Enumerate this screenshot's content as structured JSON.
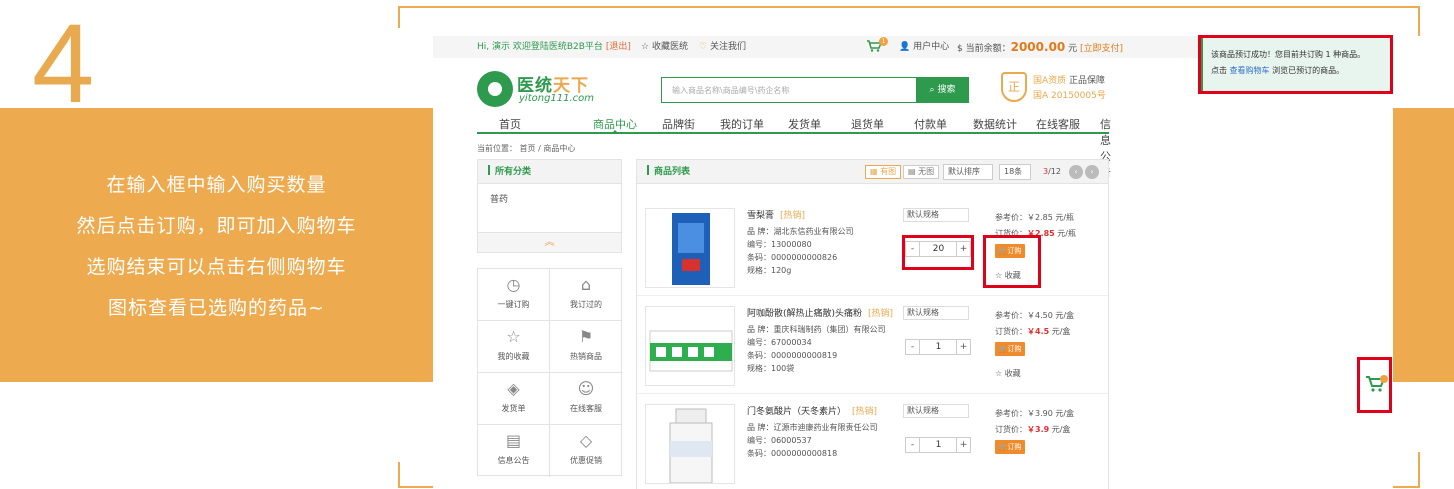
{
  "tutorial": {
    "step": "4",
    "lines": [
      "在输入框中输入购买数量",
      "然后点击订购，即可加入购物车",
      "选购结束可以点击右侧购物车",
      "图标查看已选购的药品~"
    ]
  },
  "topbar": {
    "greeting": "Hi, 演示 欢迎登陆医统B2B平台",
    "logout": "[退出]",
    "favorite": "收藏医统",
    "follow": "关注我们",
    "cart_count": "1",
    "user_center": "用户中心",
    "balance_label": "当前余额：",
    "balance_value": "2000.00",
    "balance_unit": "元",
    "pay_link": "[立即支付]"
  },
  "logo": {
    "name_green": "医统",
    "name_orange": "天下",
    "sub": "yitong111.com"
  },
  "search": {
    "placeholder": "输入商品名称\\商品编号\\药企名称",
    "button": "搜索"
  },
  "guarantee": {
    "shield": "正",
    "line1a": "国A资质",
    "line1b": " 正品保障",
    "line2": "国A 20150005号"
  },
  "nav": {
    "items": [
      "首页",
      "商品中心",
      "品牌街",
      "我的订单",
      "发货单",
      "退货单",
      "付款单",
      "数据统计",
      "在线客服",
      "信息公告"
    ]
  },
  "breadcrumb": "当前位置： 首页 / 商品中心",
  "category": {
    "title": "所有分类",
    "item": "普药",
    "fold": "︽"
  },
  "quick_links": [
    {
      "icon": "◷",
      "label": "一键订购"
    },
    {
      "icon": "⌂",
      "label": "我订过的"
    },
    {
      "icon": "☆",
      "label": "我的收藏"
    },
    {
      "icon": "⚑",
      "label": "热销商品"
    },
    {
      "icon": "◈",
      "label": "发货单"
    },
    {
      "icon": "☺",
      "label": "在线客服"
    },
    {
      "icon": "▤",
      "label": "信息公告"
    },
    {
      "icon": "◇",
      "label": "优惠促销"
    }
  ],
  "list": {
    "title": "商品列表",
    "view_grid": "有图",
    "view_list": "无图",
    "sort": "默认排序",
    "per_page": "18条",
    "page_current": "3",
    "page_total": "/12"
  },
  "products": [
    {
      "name": "雪梨膏",
      "tag": "[热销]",
      "brand": "品 牌：湖北东信药业有限公司",
      "code": "编号：13000080",
      "barcode": "条码：0000000000826",
      "size": "规格：120g",
      "spec": "默认规格",
      "qty": "20",
      "ref_price": "参考价：￥2.85 元/瓶",
      "order_price_label": "订货价：",
      "order_price": "￥2.85",
      "order_price_unit": " 元/瓶",
      "order_btn": "订购",
      "collect": "☆ 收藏"
    },
    {
      "name": "阿咖酚散(解热止痛散)头痛粉",
      "tag": "[热销]",
      "brand": "品 牌：重庆科瑞制药（集团）有限公司",
      "code": "编号：67000034",
      "barcode": "条码：0000000000819",
      "size": "规格：100袋",
      "spec": "默认规格",
      "qty": "1",
      "ref_price": "参考价：￥4.50 元/盒",
      "order_price_label": "订货价：",
      "order_price": "￥4.5",
      "order_price_unit": " 元/盒",
      "order_btn": "订购",
      "collect": "☆ 收藏"
    },
    {
      "name": "门冬氨酸片（天冬素片）",
      "tag": "[热销]",
      "brand": "品 牌：辽源市迪康药业有限责任公司",
      "code": "编号：06000537",
      "barcode": "条码：0000000000818",
      "size": "",
      "spec": "默认规格",
      "qty": "1",
      "ref_price": "参考价：￥3.90 元/盒",
      "order_price_label": "订货价：",
      "order_price": "￥3.9",
      "order_price_unit": " 元/盒",
      "order_btn": "订购",
      "collect": ""
    }
  ],
  "toast": {
    "line1": "该商品预订成功！您目前共订购 1 种商品。",
    "line2a": "点击 ",
    "link": "查看购物车",
    "line2b": " 浏览已预订的商品。"
  },
  "colors": {
    "brand_green": "#2e9a4e",
    "tutorial_orange": "#eeaa4f",
    "highlight_red": "#e0001a"
  }
}
